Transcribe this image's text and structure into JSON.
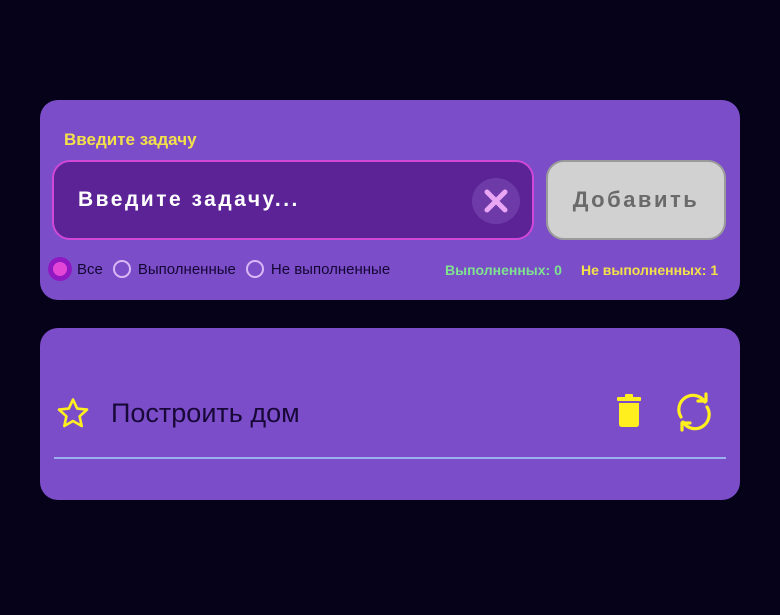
{
  "form": {
    "label": "Введите задачу",
    "placeholder": "Введите задачу...",
    "add_label": "Добавить"
  },
  "filters": {
    "selected": "all",
    "options": [
      {
        "id": "all",
        "label": "Все"
      },
      {
        "id": "done",
        "label": "Выполненные"
      },
      {
        "id": "undone",
        "label": "Не выполненные"
      }
    ]
  },
  "counters": {
    "done_text": "Выполненных: 0",
    "undone_text": "Не выполненных: 1"
  },
  "tasks": [
    {
      "text": "Построить дом",
      "done": false,
      "starred": false
    }
  ],
  "icons": {
    "clear": "close-icon",
    "star": "star-icon",
    "delete": "trash-icon",
    "toggle": "refresh-icon"
  },
  "colors": {
    "background": "#06021a",
    "card": "#7c4dc9",
    "input_bg": "#5b2396",
    "input_border": "#cf48d8",
    "label_yellow": "#f3e14a",
    "done_green": "#7fe28f",
    "icon_yellow": "#ffef1f",
    "radio_checked": "#e346d6"
  }
}
